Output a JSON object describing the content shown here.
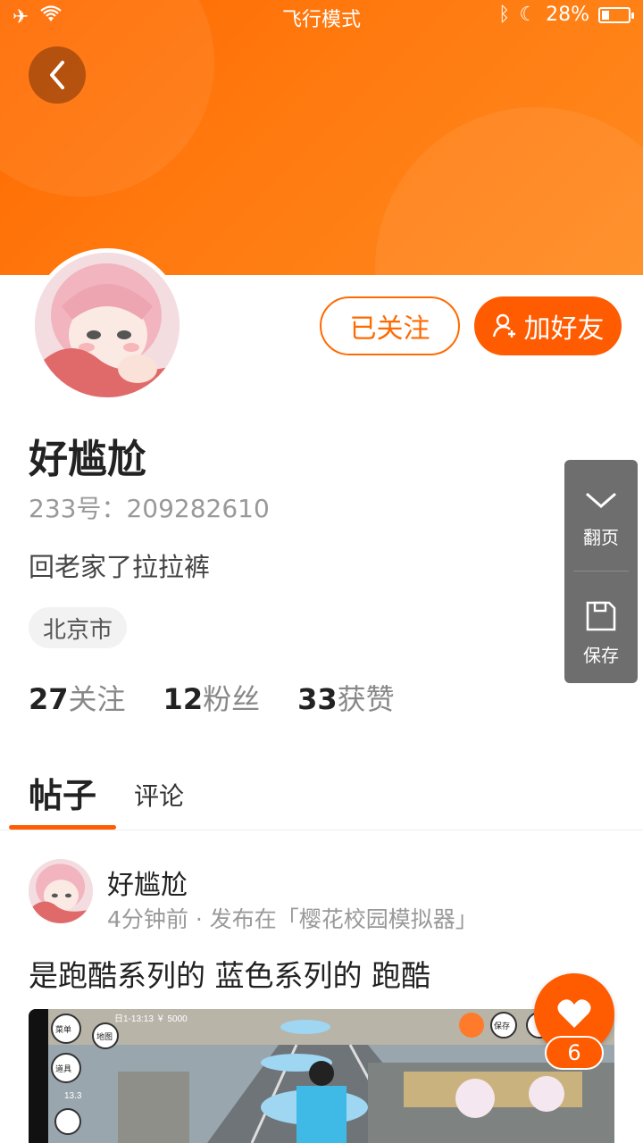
{
  "status_bar": {
    "mode": "飞行模式",
    "battery": "28%",
    "battery_level": 0.28
  },
  "profile": {
    "name": "好尴尬",
    "uid": "233号：209282610",
    "bio": "回老家了拉拉裤",
    "location": "北京市",
    "followed_label": "已关注",
    "add_friend_label": "加好友"
  },
  "stats": [
    {
      "num": "27",
      "label": "关注"
    },
    {
      "num": "12",
      "label": "粉丝"
    },
    {
      "num": "33",
      "label": "获赞"
    }
  ],
  "side_panel": {
    "page_label": "翻页",
    "save_label": "保存"
  },
  "tabs": {
    "posts": "帖子",
    "comments": "评论"
  },
  "post": {
    "author": "好尴尬",
    "meta": "4分钟前 · 发布在「樱花校园模拟器」",
    "title": "是跑酷系列的 蓝色系列的 跑酷",
    "like_count": "6",
    "game_ui": {
      "menu": "菜单",
      "map": "地图",
      "props": "道具",
      "save": "保存",
      "value": "13.3",
      "hud": "日1-13:13 ￥ 5000"
    }
  },
  "colors": {
    "accent": "#ff5b00",
    "banner": "#ff7a10"
  }
}
